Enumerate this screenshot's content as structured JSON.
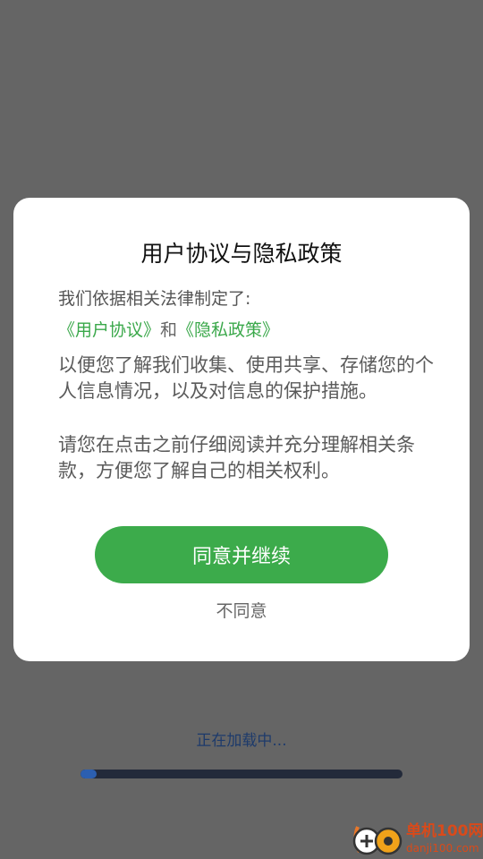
{
  "dialog": {
    "title": "用户协议与隐私政策",
    "intro": "我们依据相关法律制定了:",
    "user_agreement_link": "《用户协议》",
    "conjunction": "和",
    "privacy_policy_link": "《隐私政策》",
    "paragraph1": "以便您了解我们收集、使用共享、存储您的个人信息情况，以及对信息的保护措施。",
    "paragraph2": "请您在点击之前仔细阅读并充分理解相关条款，方便您了解自己的相关权利。",
    "agree_label": "同意并继续",
    "disagree_label": "不同意"
  },
  "loading": {
    "text": "正在加载中...",
    "progress_fraction": 0.05
  },
  "watermark": {
    "name": "单机100网",
    "url": "danji100.com"
  },
  "colors": {
    "accent_green": "#3cab4b",
    "overlay": "#656565",
    "loading_text": "#1d3a6b",
    "progress_fill": "#2c5fb0",
    "watermark": "#d94a1a"
  }
}
